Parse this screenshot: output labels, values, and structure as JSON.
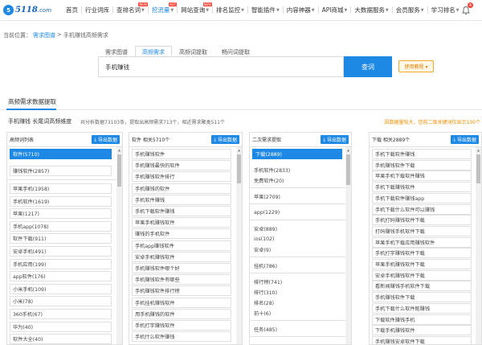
{
  "logo": {
    "mark": "5",
    "text": "5118",
    "suffix": ".com"
  },
  "nav": [
    {
      "label": "首页",
      "caret": false,
      "hot": ""
    },
    {
      "label": "行业词库",
      "caret": false,
      "hot": ""
    },
    {
      "label": "查排名词",
      "caret": true,
      "hot": "NEW"
    },
    {
      "label": "挖流量",
      "caret": true,
      "hot": "HOT",
      "active": true
    },
    {
      "label": "网站查询",
      "caret": true,
      "hot": "NEW"
    },
    {
      "label": "排名监控",
      "caret": true,
      "hot": ""
    },
    {
      "label": "智能插件",
      "caret": true,
      "hot": ""
    },
    {
      "label": "内容神器",
      "caret": true,
      "hot": ""
    },
    {
      "label": "API商城",
      "caret": true,
      "hot": ""
    },
    {
      "label": "大数据服务",
      "caret": true,
      "hot": ""
    },
    {
      "label": "会员服务",
      "caret": true,
      "hot": ""
    },
    {
      "label": "学习排名",
      "caret": true,
      "hot": ""
    }
  ],
  "notifications": {
    "count": "4"
  },
  "breadcrumb": {
    "prefix": "当前位置：",
    "link": "需求图谱",
    "sep": ">",
    "current": "手机赚钱高频需求"
  },
  "search": {
    "tabs": [
      "需求图谱",
      "高频需求",
      "高频词提取",
      "畅问词提取"
    ],
    "value": "手机赚钱",
    "button": "查词",
    "tutorial": "使用教程 ▾"
  },
  "section": {
    "title": "高频需求数据提取",
    "info": "手机赚钱 长尾词高频维度",
    "info_sub": "共分析数据73103条，提取出高频需求713个，相近需求聚类511个",
    "warn": "因数据量较大，您前二级关键词仅显示100个"
  },
  "columns": [
    {
      "title": "高频词列表",
      "export": "导出数据",
      "selected": "软件(5710)",
      "sub": "赚钱软件(2857)",
      "items": [
        "苹果手机(1958)",
        "手机软件(1619)",
        "苹果(1217)",
        "手机app(1078)",
        "软件下载(911)",
        "安卓手机(491)",
        "手机应用(199)",
        "app软件(176)",
        "小米手机(109)",
        "小米(78)",
        "360手机(67)",
        "华为(40)",
        "软件大全(40)",
        "vivo(36)"
      ]
    },
    {
      "title": "软件 相关5710个",
      "export": "导出数据",
      "items": [
        "手机赚钱软件",
        "手机赚钱最快的软件",
        "手机赚钱软件排行",
        "手机赚钱的软件",
        "手机软件赚钱",
        "手机下载软件赚钱",
        "苹果手机赚钱软件",
        "赚钱的手机软件",
        "手机app赚钱软件",
        "安卓手机赚钱软件",
        "手机赚钱软件哪个好",
        "手机赚钱软件有哪些",
        "手机赚钱软件排行榜",
        "手机挂机赚钱软件",
        "用手机赚钱的软件",
        "手机打字赚钱软件",
        "手机什么软件赚钱"
      ]
    },
    {
      "title": "二次需求提取",
      "export": "导出数据",
      "selected": "下载(2889)",
      "groups": [
        [
          "手机软件(2833)",
          "免费软件(20)"
        ],
        [
          "苹果(2709)"
        ],
        [
          "app(1229)"
        ],
        [
          "安卓(889)",
          "ios(102)",
          "安卓(9)"
        ],
        [
          "挂机(786)"
        ],
        [
          "排行榜(741)",
          "排行(310)",
          "排名(28)",
          "前十(6)"
        ],
        [
          "任务(485)"
        ]
      ]
    },
    {
      "title": "下载 相关2889个",
      "export": "导出数据",
      "items": [
        "手机下载软件赚钱",
        "手机赚钱软件下载",
        "苹果手机下载软件赚钱",
        "手机下载赚钱软件",
        "手机下载软件赚钱app",
        "手机下载什么软件可以赚钱",
        "手机打码赚钱软件下载",
        "打码赚钱手机软件下载",
        "苹果手机下载应用赚钱软件",
        "手机打字赚钱软件下载",
        "苹果手机赚钱软件下载",
        "安卓手机赚钱软件下载",
        "看新闻赚钱手机软件下载",
        "手机赚钱软件下载",
        "手机下载什么软件能赚钱",
        "下载软件赚钱手机",
        "下载手机赚钱软件",
        "手机赚钱安卓软件下载"
      ]
    }
  ],
  "colors": {
    "accent": "#1e88e5",
    "warn": "#f08c00",
    "hot": "#f44336"
  }
}
